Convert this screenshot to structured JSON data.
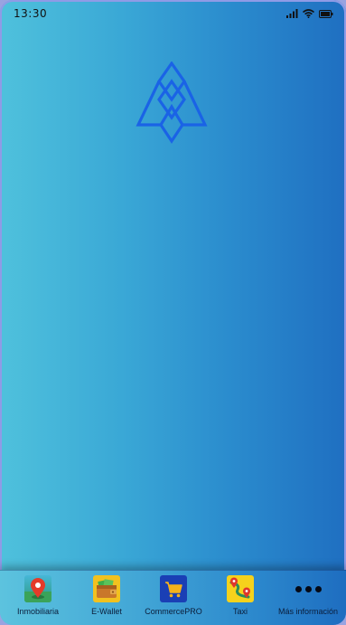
{
  "status_bar": {
    "time": "13:30"
  },
  "tabs": [
    {
      "label": "Inmobiliaria",
      "icon": "map-pin-icon"
    },
    {
      "label": "E-Wallet",
      "icon": "wallet-icon"
    },
    {
      "label": "CommercePRO",
      "icon": "shopping-cart-icon"
    },
    {
      "label": "Taxi",
      "icon": "taxi-route-icon"
    },
    {
      "label": "Más información",
      "icon": "more-dots-icon"
    }
  ],
  "colors": {
    "logo": "#1a63e6",
    "gradient_left": "#4fc1dc",
    "gradient_right": "#1f6fc1"
  }
}
